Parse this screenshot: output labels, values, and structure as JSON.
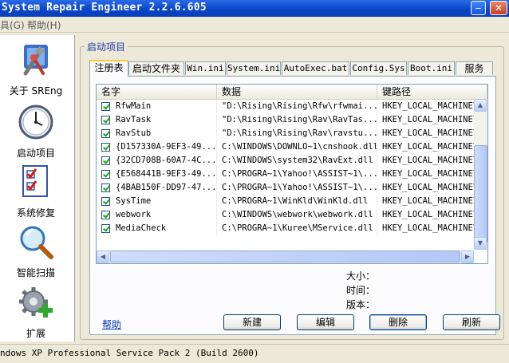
{
  "window": {
    "title": "System Repair Engineer 2.2.6.605"
  },
  "menu": {
    "tools": "具(G)",
    "help": "帮助(H)"
  },
  "nav": [
    {
      "label": "关于 SREng",
      "icon": "tools-icon"
    },
    {
      "label": "启动项目",
      "icon": "clock-icon"
    },
    {
      "label": "系统修复",
      "icon": "checklist-icon"
    },
    {
      "label": "智能扫描",
      "icon": "magnifier-icon"
    },
    {
      "label": "扩展",
      "icon": "gear-plus-icon"
    }
  ],
  "group": {
    "title": "启动项目"
  },
  "tabs": [
    "注册表",
    "启动文件夹",
    "Win.ini",
    "System.ini",
    "AutoExec.bat",
    "Config.Sys",
    "Boot.ini",
    "服务"
  ],
  "list": {
    "columns": [
      "名字",
      "数据",
      "键路径"
    ],
    "rows": [
      {
        "name": "RfwMain",
        "data": "\"D:\\Rising\\Rising\\Rfw\\rfwmai...",
        "key": "HKEY_LOCAL_MACHINE\\Sof"
      },
      {
        "name": "RavTask",
        "data": "\"D:\\Rising\\Rising\\Rav\\RavTas...",
        "key": "HKEY_LOCAL_MACHINE\\Sof"
      },
      {
        "name": "RavStub",
        "data": "\"D:\\Rising\\Rising\\Rav\\ravstu...",
        "key": "HKEY_LOCAL_MACHINE\\Sof"
      },
      {
        "name": "{D157330A-9EF3-49...",
        "data": "C:\\WINDOWS\\DOWNLO~1\\cnshook.dll",
        "key": "HKEY_LOCAL_MACHINE\\SOF"
      },
      {
        "name": "{32CD708B-60A7-4C...",
        "data": "C:\\WINDOWS\\system32\\RavExt.dll",
        "key": "HKEY_LOCAL_MACHINE\\SOF"
      },
      {
        "name": "{E568441B-9EF3-49...",
        "data": "C:\\PROGRA~1\\Yahoo!\\ASSIST~1\\...",
        "key": "HKEY_LOCAL_MACHINE\\SOF"
      },
      {
        "name": "{4BAB150F-DD97-47...",
        "data": "C:\\PROGRA~1\\Yahoo!\\ASSIST~1\\...",
        "key": "HKEY_LOCAL_MACHINE\\SOF"
      },
      {
        "name": "SysTime",
        "data": "C:\\PROGRA~1\\WinKld\\WinKld.dll",
        "key": "HKEY_LOCAL_MACHINE\\SOF"
      },
      {
        "name": "webwork",
        "data": "C:\\WINDOWS\\webwork\\webwork.dll",
        "key": "HKEY_LOCAL_MACHINE\\SOF"
      },
      {
        "name": "MediaCheck",
        "data": "C:\\PROGRA~1\\Kuree\\MService.dll",
        "key": "HKEY_LOCAL_MACHINE\\SOF"
      }
    ]
  },
  "details": {
    "size": "大小：",
    "time": "时间：",
    "version": "版本："
  },
  "buttons": {
    "help": "帮助",
    "new": "新建",
    "edit": "编辑",
    "delete": "删除",
    "refresh": "刷新"
  },
  "status": {
    "text": "ndows XP Professional Service Pack 2 (Build 2600)"
  }
}
